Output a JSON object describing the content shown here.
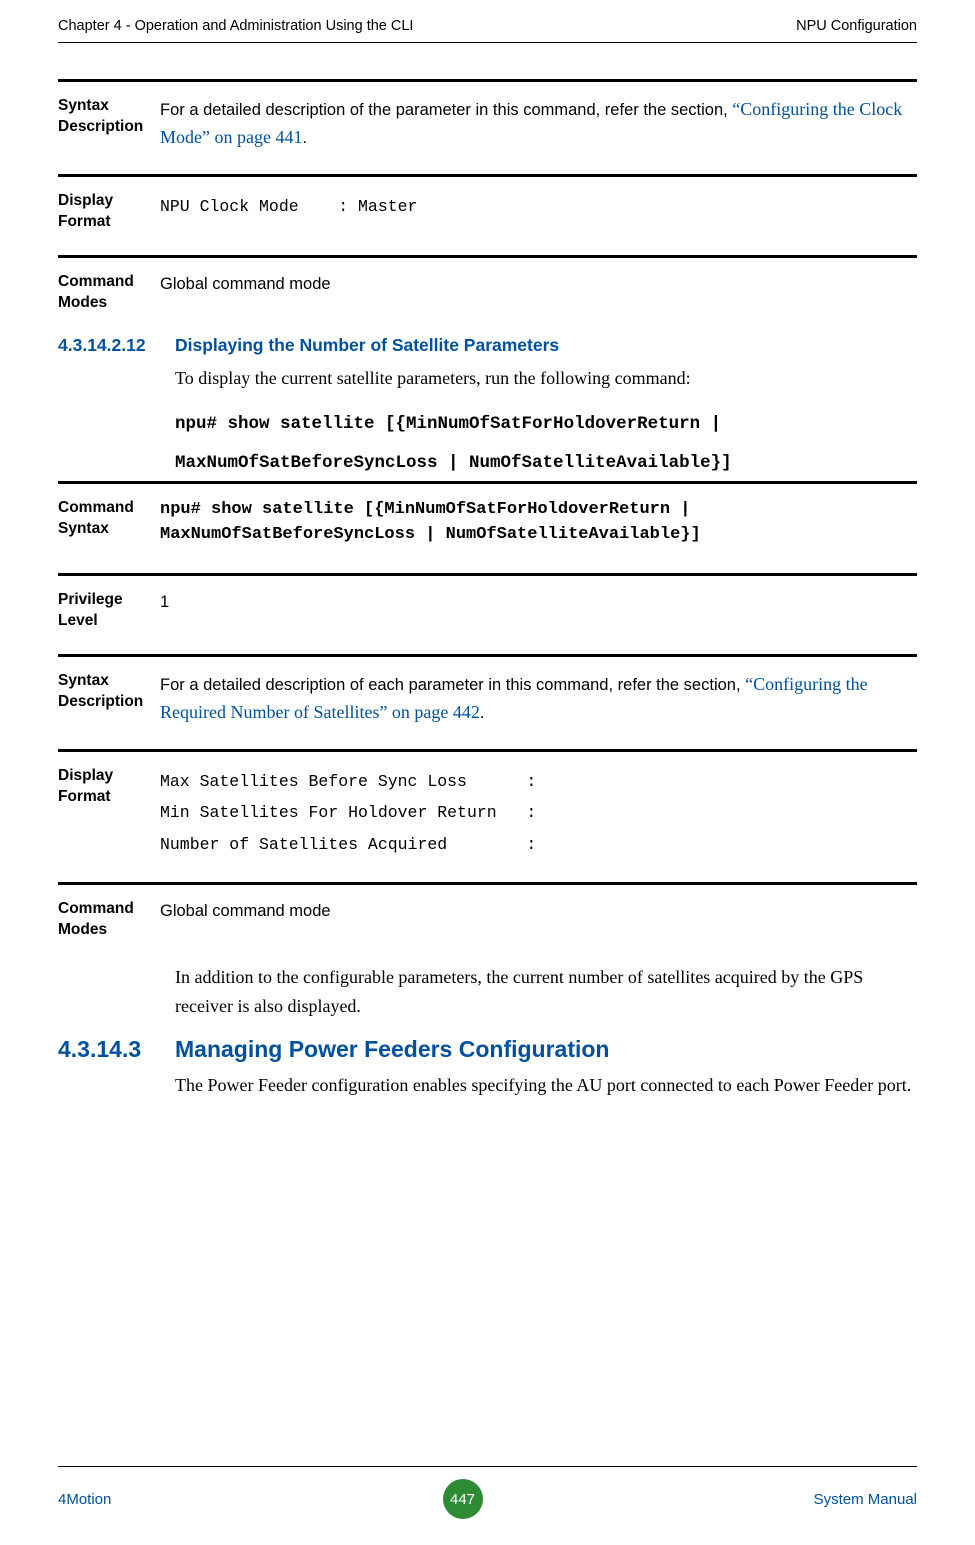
{
  "header": {
    "left": "Chapter 4 - Operation and Administration Using the CLI",
    "right": "NPU Configuration"
  },
  "blocks": {
    "syntaxDesc1": {
      "label": "Syntax Description",
      "text_pre": "For a detailed description of the parameter in this command, refer the section, ",
      "link": "“Configuring the Clock Mode” on page 441",
      "text_post": "."
    },
    "displayFormat1": {
      "label": "Display Format",
      "line": "NPU Clock Mode    : Master"
    },
    "commandModes1": {
      "label": "Command Modes",
      "text": "Global command mode"
    },
    "sec1": {
      "num": "4.3.14.2.12",
      "title": "Displaying the Number of Satellite Parameters",
      "intro": "To display the current satellite parameters, run the following command:",
      "cmd1": "npu# show satellite [{MinNumOfSatForHoldoverReturn |",
      "cmd2": "MaxNumOfSatBeforeSyncLoss | NumOfSatelliteAvailable}]"
    },
    "commandSyntax": {
      "label": "Command Syntax",
      "line1": "npu#   show satellite [{MinNumOfSatForHoldoverReturn |",
      "line2": "MaxNumOfSatBeforeSyncLoss | NumOfSatelliteAvailable}]"
    },
    "privilege": {
      "label": "Privilege Level",
      "value": "1"
    },
    "syntaxDesc2": {
      "label": "Syntax Description",
      "text_pre": "For a detailed description of each parameter in this command, refer the section, ",
      "link": "“Configuring the Required Number of Satellites” on page 442",
      "text_post": "."
    },
    "displayFormat2": {
      "label": "Display Format",
      "l1": "Max Satellites Before Sync Loss      :",
      "l2": "Min Satellites For Holdover Return   :",
      "l3": "Number of Satellites Acquired        :"
    },
    "commandModes2": {
      "label": "Command Modes",
      "text": "Global command mode"
    },
    "tailPara": "In addition to the configurable parameters, the current number of satellites acquired by the GPS receiver is also displayed.",
    "sec2": {
      "num": "4.3.14.3",
      "title": "Managing Power Feeders Configuration",
      "body": "The Power Feeder configuration enables specifying the AU port connected to each Power Feeder port."
    }
  },
  "footer": {
    "left": "4Motion",
    "page": "447",
    "right": "System Manual"
  }
}
